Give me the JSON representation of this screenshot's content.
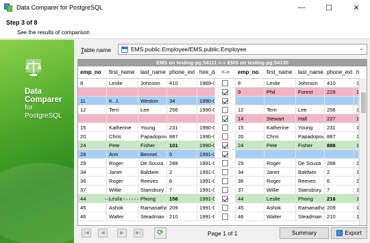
{
  "window": {
    "title": "Data Comparer for PostgreSQL",
    "minimize": "—",
    "maximize": "☐",
    "close": "✕"
  },
  "header": {
    "step": "Step 3 of 8",
    "subtitle": "See the results of comparison"
  },
  "sidebar": {
    "line1": "Data",
    "line2": "Comparer",
    "line3": "for",
    "line4": "PostgreSQL"
  },
  "table_name": {
    "label_prefix": "T",
    "label_rest": "able name",
    "value": "EMS.public.Employee/EMS.public.Employee"
  },
  "compare_header": "EMS on testing-pg:54111 <-> EMS on testing-pg:54130",
  "columns_left": [
    "emp_no",
    "first_name",
    "last_name",
    "phone_ext",
    "hire_da"
  ],
  "columns_mid": "<->",
  "columns_right": [
    "emp_no",
    "first_name",
    "last_name",
    "phone_ext",
    "hire"
  ],
  "rows": [
    {
      "state": "same",
      "checked": false,
      "left": [
        "8",
        "Leslie",
        "Johnson",
        "410",
        "1989-0"
      ],
      "right": [
        "8",
        "Leslie",
        "Johnson",
        "410",
        "198"
      ]
    },
    {
      "state": "right-only",
      "checked": true,
      "left": [
        "",
        "",
        "",
        "",
        ""
      ],
      "right": [
        "9",
        "Phil",
        "Forest",
        "229",
        "198"
      ]
    },
    {
      "state": "left-only",
      "checked": true,
      "left": [
        "11",
        "K. J.",
        "Weston",
        "34",
        "1990-0"
      ],
      "right": [
        "",
        "",
        "",
        "",
        ""
      ]
    },
    {
      "state": "same",
      "checked": false,
      "left": [
        "12",
        "Terri",
        "Lee",
        "256",
        "1990-0"
      ],
      "right": [
        "12",
        "Terri",
        "Lee",
        "256",
        "199"
      ]
    },
    {
      "state": "right-only",
      "checked": true,
      "left": [
        "",
        "",
        "",
        "",
        ""
      ],
      "right": [
        "14",
        "Stewart",
        "Hall",
        "227",
        "199"
      ]
    },
    {
      "state": "same",
      "checked": false,
      "left": [
        "15",
        "Katherine",
        "Young",
        "231",
        "1990-0"
      ],
      "right": [
        "15",
        "Katherine",
        "Young",
        "231",
        "199"
      ]
    },
    {
      "state": "same",
      "checked": false,
      "left": [
        "20",
        "Chris",
        "Papadopoulos",
        "887",
        "1990-0"
      ],
      "right": [
        "20",
        "Chris",
        "Papadopoulos",
        "887",
        "199"
      ]
    },
    {
      "state": "diff",
      "checked": true,
      "left": [
        "24",
        "Pete",
        "Fisher",
        "101",
        "1990-0"
      ],
      "right": [
        "24",
        "Pete",
        "Fisher",
        "888",
        "199"
      ]
    },
    {
      "state": "left-only",
      "checked": true,
      "left": [
        "28",
        "Ann",
        "Bennet",
        "5",
        "1991-0"
      ],
      "right": [
        "",
        "",
        "",
        "",
        ""
      ]
    },
    {
      "state": "same",
      "checked": false,
      "left": [
        "29",
        "Roger",
        "De Souza",
        "288",
        "1991-0"
      ],
      "right": [
        "29",
        "Roger",
        "De Souza",
        "288",
        "199"
      ]
    },
    {
      "state": "same",
      "checked": false,
      "left": [
        "34",
        "Janet",
        "Baldwin",
        "2",
        "1991-0"
      ],
      "right": [
        "34",
        "Janet",
        "Baldwin",
        "2",
        "199"
      ]
    },
    {
      "state": "same",
      "checked": false,
      "left": [
        "36",
        "Roger",
        "Reeves",
        "6",
        "1991-0"
      ],
      "right": [
        "36",
        "Roger",
        "Reeves",
        "6",
        "199"
      ]
    },
    {
      "state": "same",
      "checked": false,
      "left": [
        "37",
        "Willie",
        "Stansbury",
        "7",
        "1991-0"
      ],
      "right": [
        "37",
        "Willie",
        "Stansbury",
        "7",
        "199"
      ]
    },
    {
      "state": "diff",
      "checked": true,
      "left": [
        "44",
        "Leslie",
        "Phong",
        "156",
        "1991-0"
      ],
      "right": [
        "44",
        "Leslie",
        "Phong",
        "216",
        "199"
      ]
    },
    {
      "state": "same",
      "checked": false,
      "left": [
        "45",
        "Ashok",
        "Ramanathan",
        "209",
        "1991-0"
      ],
      "right": [
        "45",
        "Ashok",
        "Ramanathan",
        "209",
        "199"
      ]
    },
    {
      "state": "same",
      "checked": false,
      "left": [
        "46",
        "Walter",
        "Steadman",
        "210",
        "1991-0"
      ],
      "right": [
        "46",
        "Walter",
        "Steadman",
        "210",
        "199"
      ]
    }
  ],
  "colors": {
    "same": "#ffffff",
    "left-only": "#a9cdf2",
    "right-only": "#efb6c6",
    "diff": "#c8e6c4",
    "accent": "#3c8fd6"
  },
  "footer": {
    "first": "|◀",
    "prev": "◀",
    "next": "▶",
    "last": "▶|",
    "refresh": "⟳",
    "page": "Page 1 of 1",
    "summary": "Summary",
    "export": "Export"
  }
}
